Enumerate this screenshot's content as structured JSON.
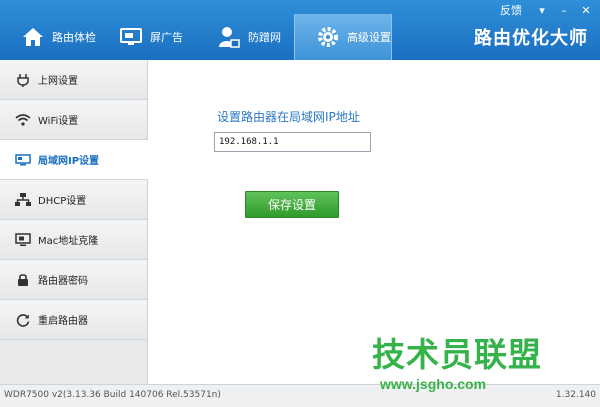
{
  "app": {
    "title": "路由优化大师"
  },
  "window": {
    "feedback_label": "反馈",
    "menu_glyph": "▾",
    "minimize_glyph": "–",
    "close_glyph": "✕"
  },
  "nav": {
    "tabs": [
      {
        "label": "路由体检",
        "icon": "home-icon"
      },
      {
        "label": "屏广告",
        "icon": "screen-icon"
      },
      {
        "label": "防蹭网",
        "icon": "user-lock-icon"
      },
      {
        "label": "高级设置",
        "icon": "gear-icon",
        "active": true
      }
    ]
  },
  "sidebar": {
    "items": [
      {
        "label": "上网设置",
        "icon": "plug-icon"
      },
      {
        "label": "WiFi设置",
        "icon": "wifi-icon"
      },
      {
        "label": "局域网IP设置",
        "icon": "lan-icon",
        "active": true
      },
      {
        "label": "DHCP设置",
        "icon": "network-tree-icon"
      },
      {
        "label": "Mac地址克隆",
        "icon": "monitor-icon"
      },
      {
        "label": "路由器密码",
        "icon": "lock-icon"
      },
      {
        "label": "重启路由器",
        "icon": "refresh-icon"
      }
    ]
  },
  "main": {
    "field_label": "设置路由器在局域网IP地址",
    "ip_value": "192.168.1.1",
    "save_label": "保存设置"
  },
  "watermark": {
    "text": "技术员联盟",
    "url": "www.jsgho.com"
  },
  "status": {
    "left": "WDR7500 v2(3.13.36 Build 140706 Rel.53571n)",
    "right": "1.32.140"
  },
  "colors": {
    "header": "#1a6fc0",
    "accent": "#2b78c2",
    "save": "#3aa535",
    "watermark": "#36b24a"
  }
}
